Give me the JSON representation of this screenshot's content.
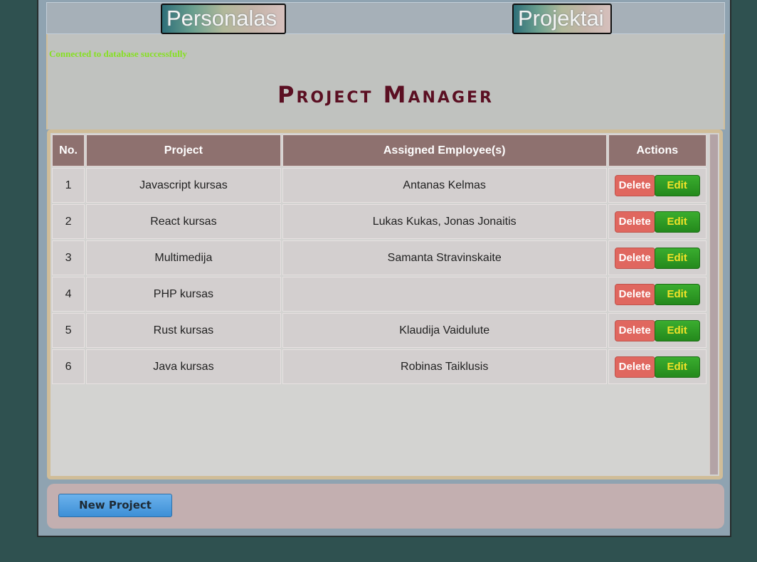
{
  "nav": {
    "personal_label": "Personalas",
    "projects_label": "Projektai"
  },
  "status": {
    "message": "Connected to database successfully"
  },
  "header": {
    "title": "Project Manager"
  },
  "table": {
    "headers": {
      "no": "No.",
      "project": "Project",
      "employees": "Assigned Employee(s)",
      "actions": "Actions"
    },
    "rows": [
      {
        "no": "1",
        "project": "Javascript kursas",
        "employees": "Antanas Kelmas",
        "delete": "Delete",
        "edit": "Edit"
      },
      {
        "no": "2",
        "project": "React kursas",
        "employees": "Lukas Kukas, Jonas Jonaitis",
        "delete": "Delete",
        "edit": "Edit"
      },
      {
        "no": "3",
        "project": "Multimedija",
        "employees": "Samanta Stravinskaite",
        "delete": "Delete",
        "edit": "Edit"
      },
      {
        "no": "4",
        "project": "PHP kursas",
        "employees": "",
        "delete": "Delete",
        "edit": "Edit"
      },
      {
        "no": "5",
        "project": "Rust kursas",
        "employees": "Klaudija Vaidulute",
        "delete": "Delete",
        "edit": "Edit"
      },
      {
        "no": "6",
        "project": "Java kursas",
        "employees": "Robinas Taiklusis",
        "delete": "Delete",
        "edit": "Edit"
      }
    ]
  },
  "footer": {
    "new_project_label": "New Project"
  },
  "colors": {
    "background": "#2f5150",
    "header_row": "#8e716f",
    "title": "#5b0f22",
    "status": "#86e022",
    "delete_button": "#e0675f",
    "edit_button": "#2f9e26",
    "edit_text": "#f2e228",
    "new_button": "#4f9ee0"
  }
}
